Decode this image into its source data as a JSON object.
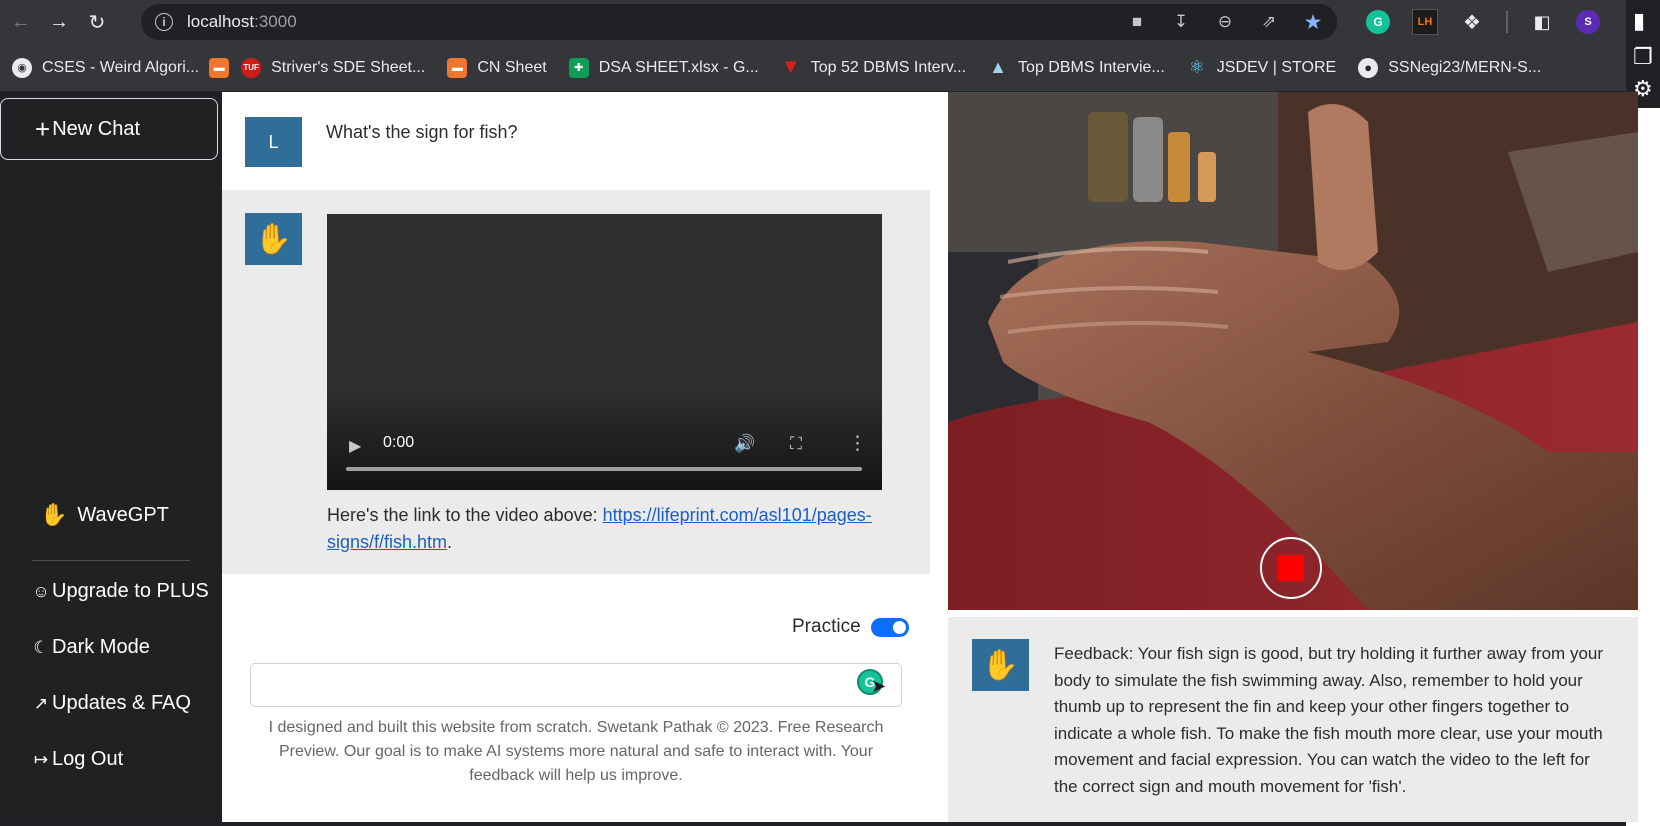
{
  "browser": {
    "url_host": "localhost",
    "url_port": ":3000",
    "bookmarks": [
      {
        "label": "CSES - Weird Algori...",
        "icon": "globe-icon"
      },
      {
        "label": "",
        "icon": "codingninjas-icon"
      },
      {
        "label": "Striver's SDE Sheet...",
        "icon": "tuf-icon"
      },
      {
        "label": "CN Sheet",
        "icon": "codingninjas-icon"
      },
      {
        "label": "DSA SHEET.xlsx - G...",
        "icon": "sheets-icon"
      },
      {
        "label": "Top 52 DBMS Interv...",
        "icon": "red-triangle-icon"
      },
      {
        "label": "Top DBMS Intervie...",
        "icon": "mountain-icon"
      },
      {
        "label": "JSDEV | STORE",
        "icon": "react-icon"
      },
      {
        "label": "SSNegi23/MERN-S...",
        "icon": "github-icon"
      }
    ],
    "ext_lh": "LH",
    "ext_grammarly": "G",
    "profile_initial": "S"
  },
  "sidebar": {
    "new_chat": "New Chat",
    "brand": "WaveGPT",
    "items": [
      {
        "label": "Upgrade to PLUS",
        "icon": "user-icon"
      },
      {
        "label": "Dark Mode",
        "icon": "moon-icon"
      },
      {
        "label": "Updates & FAQ",
        "icon": "external-link-icon"
      },
      {
        "label": "Log Out",
        "icon": "logout-icon"
      }
    ]
  },
  "chat": {
    "user_initial": "L",
    "user_message": "What's the sign for fish?",
    "video_time": "0:00",
    "bot_prefix": "Here's the link to the video above: ",
    "bot_link": "https://lifeprint.com/asl101/pages-signs/f/fish.htm",
    "bot_suffix": ".",
    "practice_label": "Practice",
    "practice_on": true,
    "input_value": "",
    "footer": "I designed and built this website from scratch. Swetank Pathak © 2023. Free Research Preview. Our goal is to make AI systems more natural and safe to interact with. Your feedback will help us improve."
  },
  "feedback": {
    "text": "Feedback: Your fish sign is good, but try holding it further away from your body to simulate the fish swimming away. Also, remember to hold your thumb up to represent the fin and keep your other fingers together to indicate a whole fish. To make the fish mouth more clear, use your mouth movement and facial expression. You can watch the video to the left for the correct sign and mouth movement for 'fish'."
  },
  "colors": {
    "sidebar_bg": "#202123",
    "avatar_bg": "#2f6e98",
    "message_bg": "#ebebeb",
    "toggle_on": "#0d6efd",
    "record_stop": "#ff0000"
  }
}
